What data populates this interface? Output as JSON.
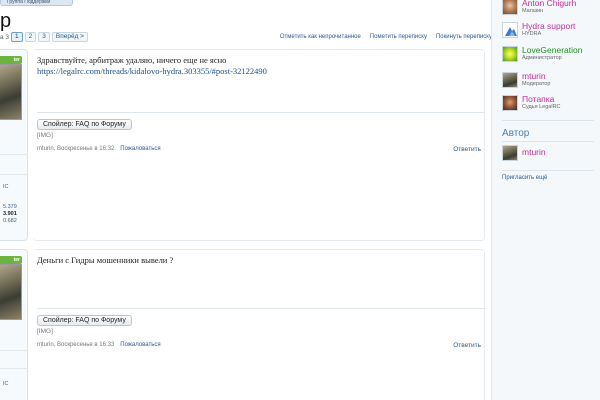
{
  "breadcrumb": {
    "text": "Группа Поддержки"
  },
  "page": {
    "title": "р"
  },
  "pagination": {
    "prefix": "а 3",
    "pages": [
      "1",
      "2",
      "3"
    ],
    "current": "1",
    "next_label": "Вперёд >"
  },
  "top_actions": {
    "mark_unread": "Отметить как непрочитанное",
    "mark_dialog": "Пометить переписку",
    "leave_dialog": "Покинуть переписку"
  },
  "posts": [
    {
      "badge": "ter",
      "stats": [
        "ІС",
        "5.379",
        "3.901",
        "0.682"
      ],
      "text": "Здравствуйте, арбитраж удаляю, ничего еще не ясно",
      "link": "https://legalrc.com/threads/kidalovo-hydra.303355/#post-32122490",
      "spoiler": "Спойлер: FAQ по Форуму",
      "img": "[IMG]",
      "meta": "mturin, Воскресенье в 16:32",
      "report": "Пожаловаться",
      "reply": "Ответить"
    },
    {
      "badge": "ter",
      "stats": [
        "ІС"
      ],
      "text": "Деньги с Гидры мошенники вывели ?",
      "link": "",
      "spoiler": "Спойлер: FAQ по Форуму",
      "img": "[IMG]",
      "meta": "mturin, Воскресенье в 16:33",
      "report": "Пожаловаться",
      "reply": "Ответить"
    }
  ],
  "sidebar": {
    "participants": [
      {
        "name": "Anton Chigurh",
        "role": "Магазин",
        "color": "#c0309a"
      },
      {
        "name": "Hydra support",
        "role": "HYDRA",
        "color": "#c0309a"
      },
      {
        "name": "LoveGeneration",
        "role": "Администратор",
        "color": "#1f8f1f"
      },
      {
        "name": "mturin",
        "role": "Модератор",
        "color": "#c0309a"
      },
      {
        "name": "Потапка",
        "role": "Судья LegalRC",
        "color": "#c0309a"
      }
    ],
    "author_heading": "Автор",
    "author": {
      "name": "mturin",
      "color": "#c0309a"
    },
    "invite_more": "Пригласить ещё"
  }
}
